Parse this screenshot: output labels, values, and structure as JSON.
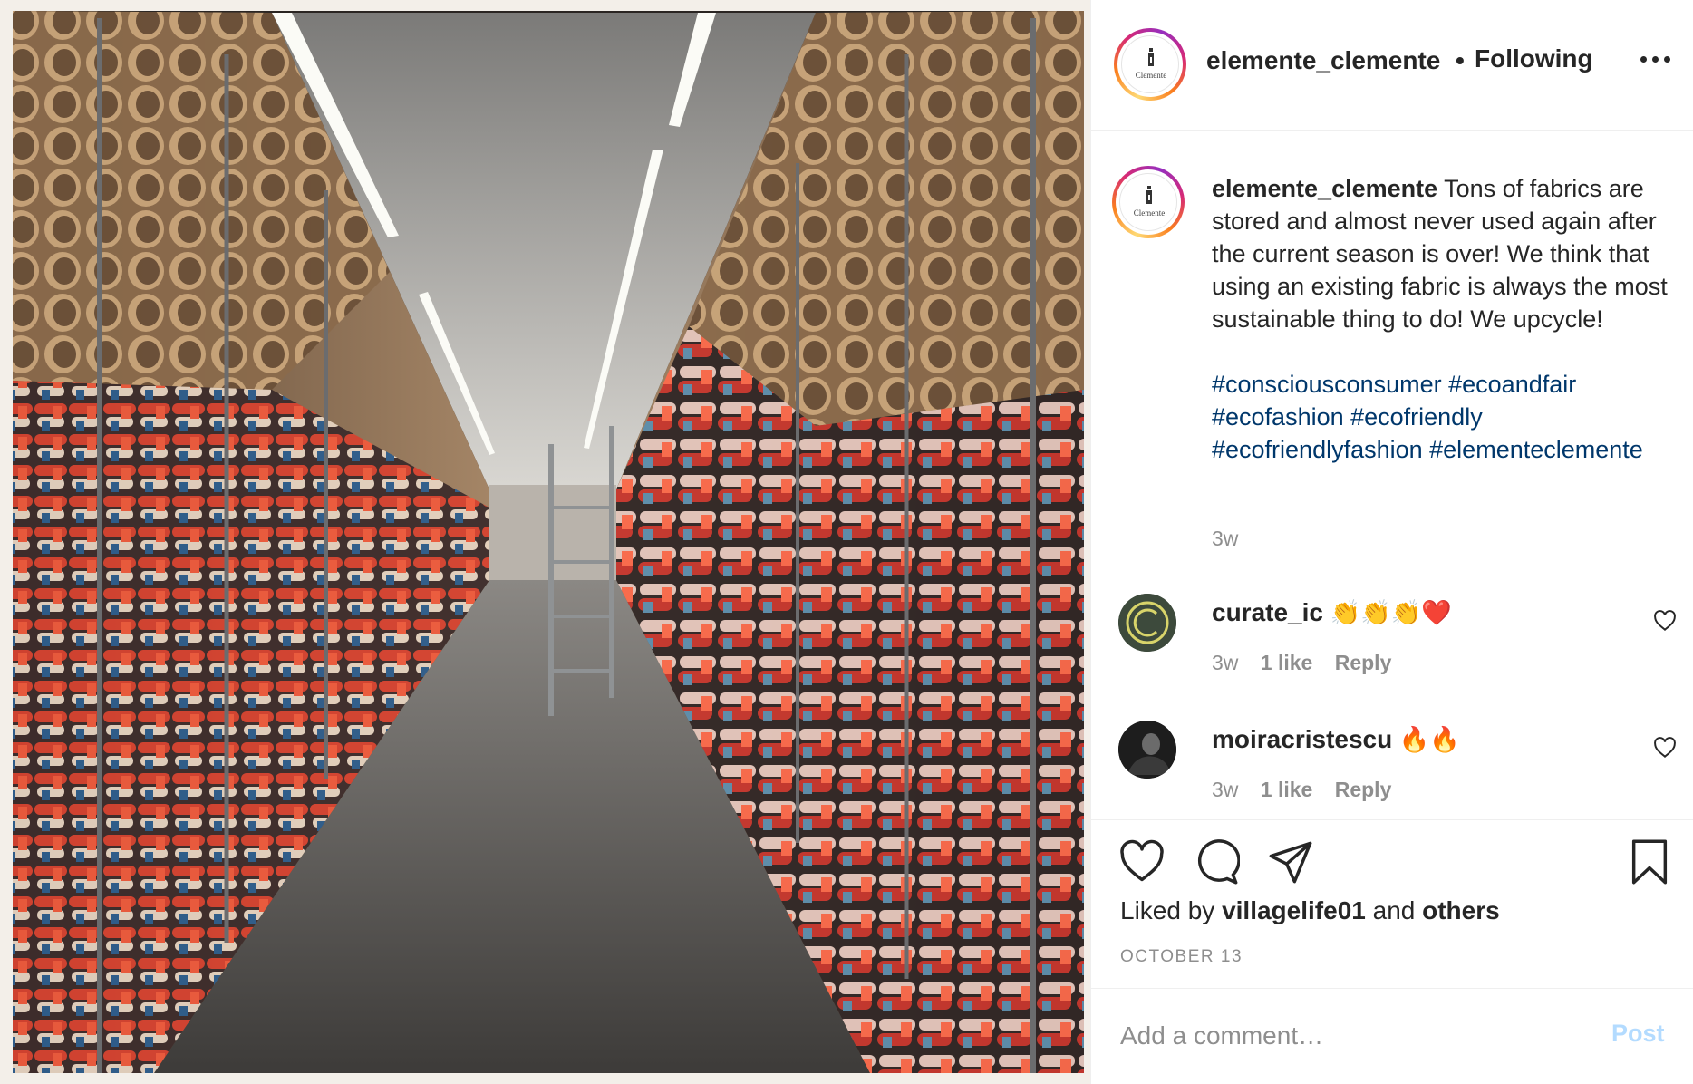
{
  "post": {
    "username": "elemente_clemente",
    "separator": "•",
    "follow_status": "Following",
    "logo_text": "Clemente",
    "caption": "Tons of fabrics are stored and almost never used again after the current season is over! We think that using an existing fabric is always the most sustainable thing to do! We upcycle!",
    "hashtags": "#consciousconsumer #ecoandfair #ecofashion #ecofriendly #ecofriendlyfashion #elementeclemente",
    "caption_time": "3w"
  },
  "comments": [
    {
      "username": "curate_ic",
      "text": "👏👏👏❤️",
      "time": "3w",
      "likes": "1 like",
      "reply": "Reply"
    },
    {
      "username": "moiracristescu",
      "text": "🔥🔥",
      "time": "3w",
      "likes": "1 like",
      "reply": "Reply"
    }
  ],
  "likes": {
    "prefix": "Liked by",
    "user": "villagelife01",
    "middle": "and",
    "suffix": "others"
  },
  "date": "OCTOBER 13",
  "add_comment": {
    "placeholder": "Add a comment…",
    "post_label": "Post"
  },
  "colors": {
    "link": "#00376b",
    "muted": "#8e8e8e",
    "post_disabled": "#b3dbff",
    "text": "#262626"
  },
  "icons": [
    "more-icon",
    "heart-icon",
    "comment-icon",
    "share-icon",
    "bookmark-icon",
    "small-heart-icon"
  ]
}
